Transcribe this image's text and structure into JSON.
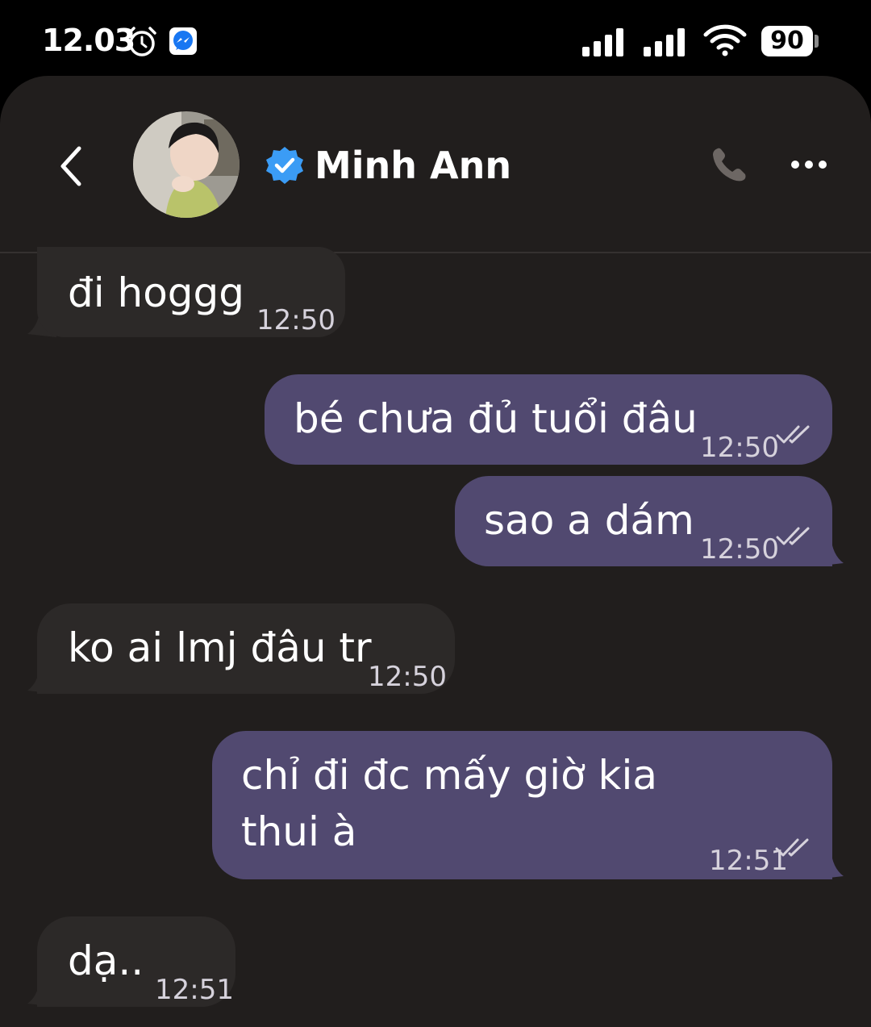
{
  "status_bar": {
    "time": "12.03",
    "battery": "90",
    "icons": [
      "alarm-icon",
      "messenger-icon",
      "signal-icon",
      "signal-icon",
      "wifi-icon",
      "battery-icon"
    ]
  },
  "header": {
    "contact_name": "Minh Ann",
    "verified": true,
    "icons": [
      "back-icon",
      "verified-badge-icon",
      "call-icon",
      "more-options-icon"
    ]
  },
  "messages": [
    {
      "direction": "incoming",
      "text": "đi hoggg",
      "time": "12:50"
    },
    {
      "direction": "outgoing",
      "text": "bé chưa đủ tuổi đâu",
      "time": "12:50",
      "read": true
    },
    {
      "direction": "outgoing",
      "text": "sao a dám",
      "time": "12:50",
      "read": true
    },
    {
      "direction": "incoming",
      "text": "ko ai lmj đâu tr",
      "time": "12:50"
    },
    {
      "direction": "outgoing",
      "text_lines": [
        "chỉ đi đc mấy giờ kia",
        "thui à"
      ],
      "time": "12:51",
      "read": true
    },
    {
      "direction": "incoming",
      "text": "dạ..",
      "time": "12:51"
    }
  ],
  "colors": {
    "background": "#211e1d",
    "incoming_bubble": "#2c2928",
    "outgoing_bubble": "#514970",
    "verified_badge": "#3b9cf5",
    "text": "#ffffff"
  }
}
